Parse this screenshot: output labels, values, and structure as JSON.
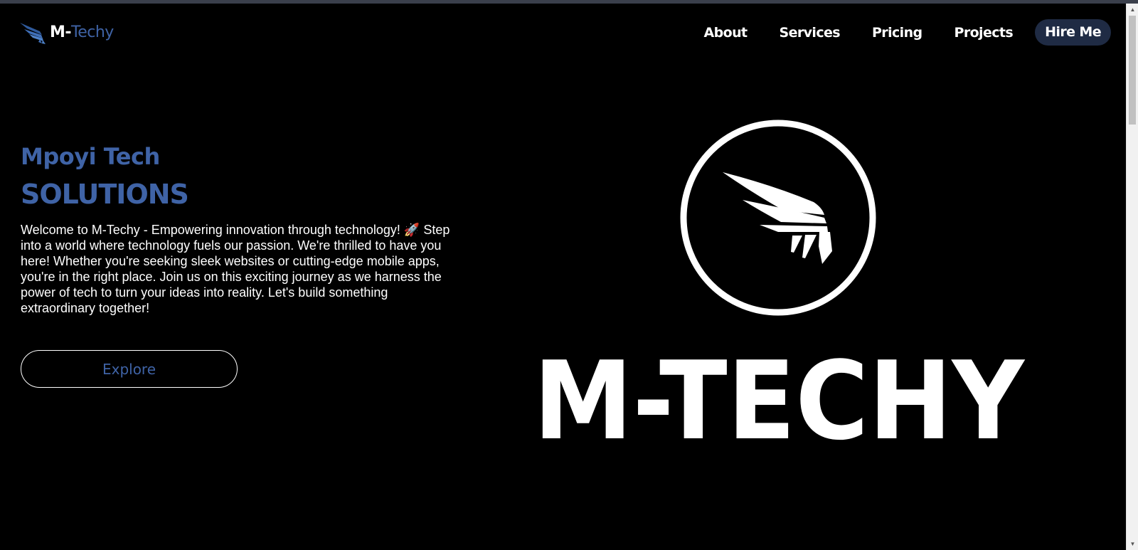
{
  "brand": {
    "name_prefix": "M-",
    "name_suffix": "Techy"
  },
  "nav": {
    "items": [
      {
        "label": "About"
      },
      {
        "label": "Services"
      },
      {
        "label": "Pricing"
      },
      {
        "label": "Projects"
      }
    ],
    "cta_label": "Hire Me"
  },
  "hero": {
    "subtitle": "Mpoyi Tech",
    "title": "SOLUTIONS",
    "paragraph": "Welcome to M-Techy - Empowering innovation through technology! 🚀 Step into a world where technology fuels our passion. We're thrilled to have you here! Whether you're seeking sleek websites or cutting-edge mobile apps, you're in the right place. Join us on this exciting journey as we harness the power of tech to turn your ideas into reality. Let's build something extraordinary together!",
    "button_label": "Explore",
    "wordmark": "M-TECHY"
  },
  "colors": {
    "background": "#000000",
    "accent": "#3f63a6",
    "cta_bg": "#1f2b44"
  },
  "icons": {
    "brand_logo": "wing-icon",
    "emblem": "wing-emblem-icon"
  }
}
